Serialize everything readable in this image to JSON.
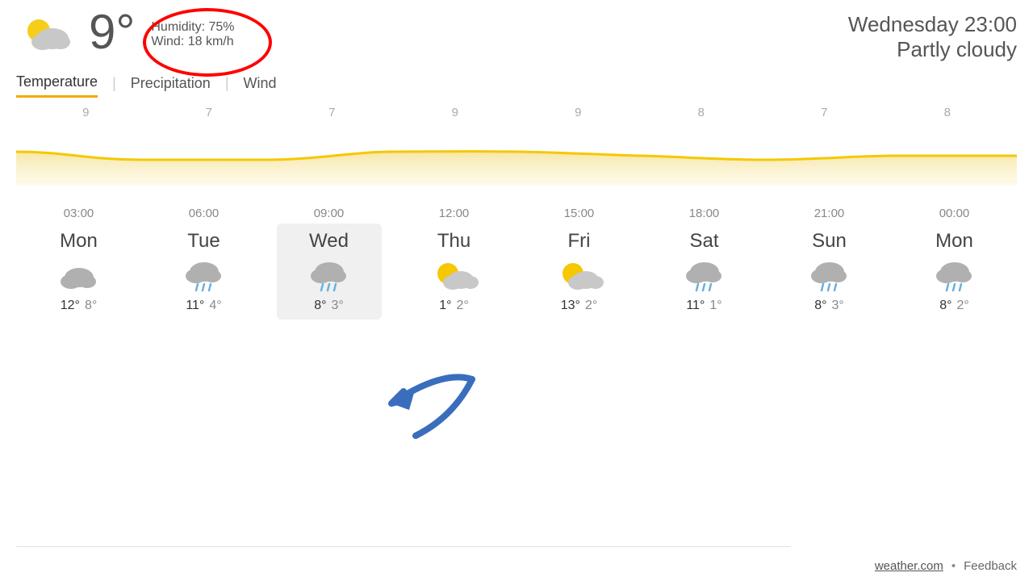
{
  "header": {
    "temperature": "9°",
    "humidity": "Humidity: 75%",
    "wind": "Wind: 18 km/h",
    "day_time": "Wednesday 23:00",
    "condition": "Partly cloudy"
  },
  "tabs": [
    {
      "label": "Temperature",
      "active": true
    },
    {
      "label": "Precipitation",
      "active": false
    },
    {
      "label": "Wind",
      "active": false
    }
  ],
  "chart": {
    "values": [
      9,
      7,
      7,
      9,
      9,
      8,
      7,
      8
    ],
    "color": "#f5c800"
  },
  "times": [
    "03:00",
    "06:00",
    "09:00",
    "12:00",
    "15:00",
    "18:00",
    "21:00",
    "00:00"
  ],
  "days": [
    {
      "name": "Mon",
      "high": "12°",
      "low": "8°",
      "icon": "cloud",
      "highlighted": false
    },
    {
      "name": "Tue",
      "high": "11°",
      "low": "4°",
      "icon": "cloud-rain",
      "highlighted": false
    },
    {
      "name": "Wed",
      "high": "8°",
      "low": "3°",
      "icon": "cloud-rain",
      "highlighted": true
    },
    {
      "name": "Thu",
      "high": "1°",
      "low": "2°",
      "icon": "cloud-sun",
      "highlighted": false
    },
    {
      "name": "Fri",
      "high": "13°",
      "low": "2°",
      "icon": "cloud-sun",
      "highlighted": false
    },
    {
      "name": "Sat",
      "high": "11°",
      "low": "1°",
      "icon": "cloud-rain",
      "highlighted": false
    },
    {
      "name": "Sun",
      "high": "8°",
      "low": "3°",
      "icon": "cloud-rain",
      "highlighted": false
    },
    {
      "name": "Mon",
      "high": "8°",
      "low": "2°",
      "icon": "cloud-rain",
      "highlighted": false
    }
  ],
  "footer": {
    "source": "weather.com",
    "feedback": "Feedback"
  }
}
